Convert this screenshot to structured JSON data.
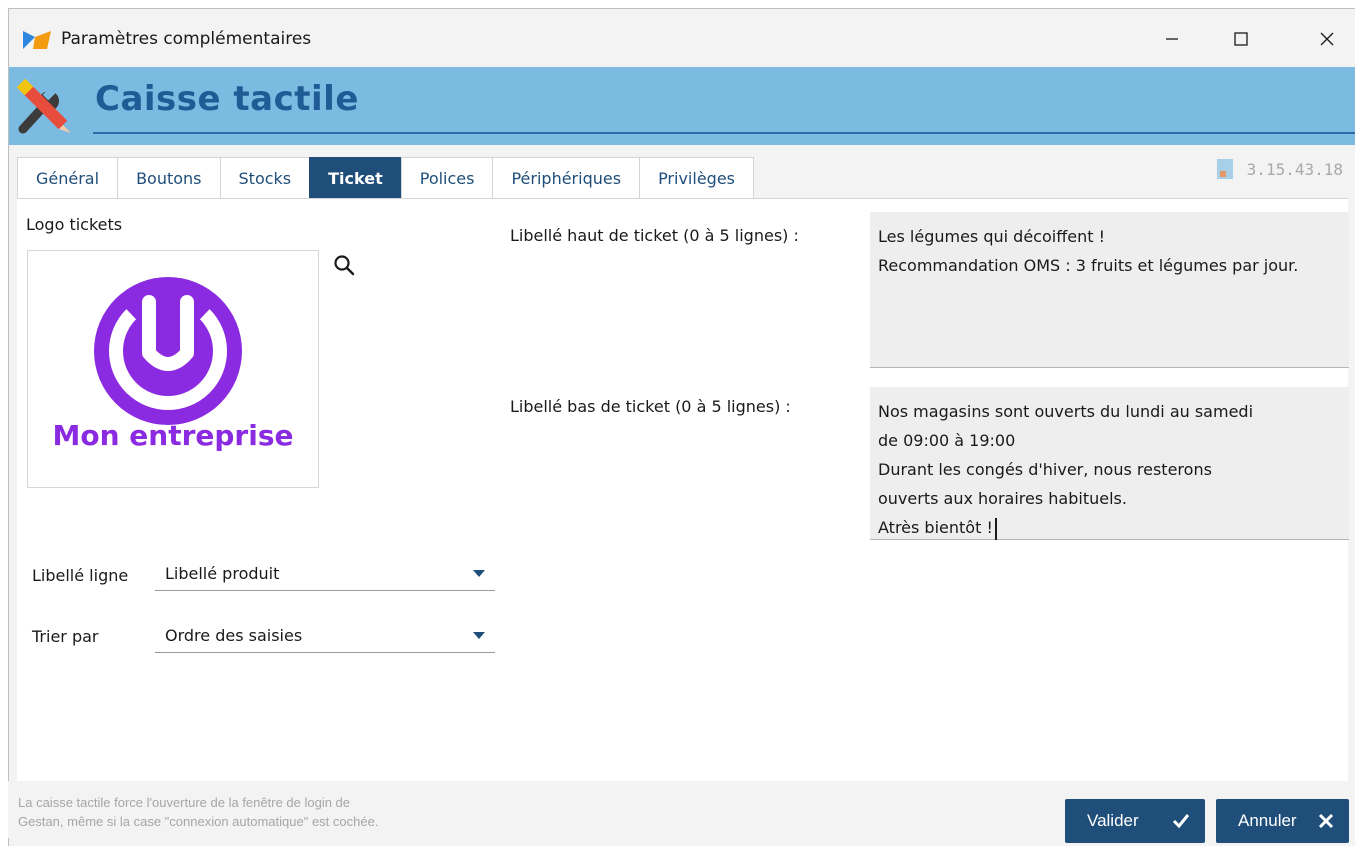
{
  "window": {
    "title": "Paramètres complémentaires",
    "controls": {
      "minimize": "minimize",
      "maximize": "maximize",
      "close": "close"
    }
  },
  "banner": {
    "title": "Caisse tactile",
    "icon": "tools-icon",
    "background_color": "#7bbbe2",
    "title_color": "#1f5b95"
  },
  "tabs": [
    {
      "label": "Général",
      "active": false
    },
    {
      "label": "Boutons",
      "active": false
    },
    {
      "label": "Stocks",
      "active": false
    },
    {
      "label": "Ticket",
      "active": true
    },
    {
      "label": "Polices",
      "active": false
    },
    {
      "label": "Périphériques",
      "active": false
    },
    {
      "label": "Privilèges",
      "active": false
    }
  ],
  "version": {
    "text": "3.15.43.18",
    "icon": "version-file-icon"
  },
  "logo": {
    "label": "Logo tickets",
    "company_text": "Mon entreprise",
    "brand_color": "#8a2be2",
    "search_icon": "search-icon"
  },
  "fields": {
    "libelle_ligne": {
      "label": "Libellé ligne",
      "value": "Libellé produit"
    },
    "trier_par": {
      "label": "Trier par",
      "value": "Ordre des saisies"
    },
    "haut_ticket": {
      "label": "Libellé haut de ticket (0 à 5 lignes) :",
      "lines": [
        "Les légumes qui décoiffent !",
        "Recommandation OMS : 3 fruits et légumes par jour."
      ]
    },
    "bas_ticket": {
      "label": "Libellé bas de ticket (0 à 5 lignes) :",
      "lines": [
        "Nos magasins sont ouverts du lundi au samedi",
        "de 09:00 à 19:00",
        "Durant les congés d'hiver, nous resterons",
        "ouverts aux horaires habituels.",
        "Atrès bientôt !"
      ]
    }
  },
  "footer": {
    "note_line1": "La caisse tactile force l'ouverture de la fenêtre de login de",
    "note_line2": "Gestan, même si la case \"connexion automatique\" est cochée.",
    "validate_label": "Valider",
    "cancel_label": "Annuler",
    "button_color": "#1f4e7a"
  }
}
